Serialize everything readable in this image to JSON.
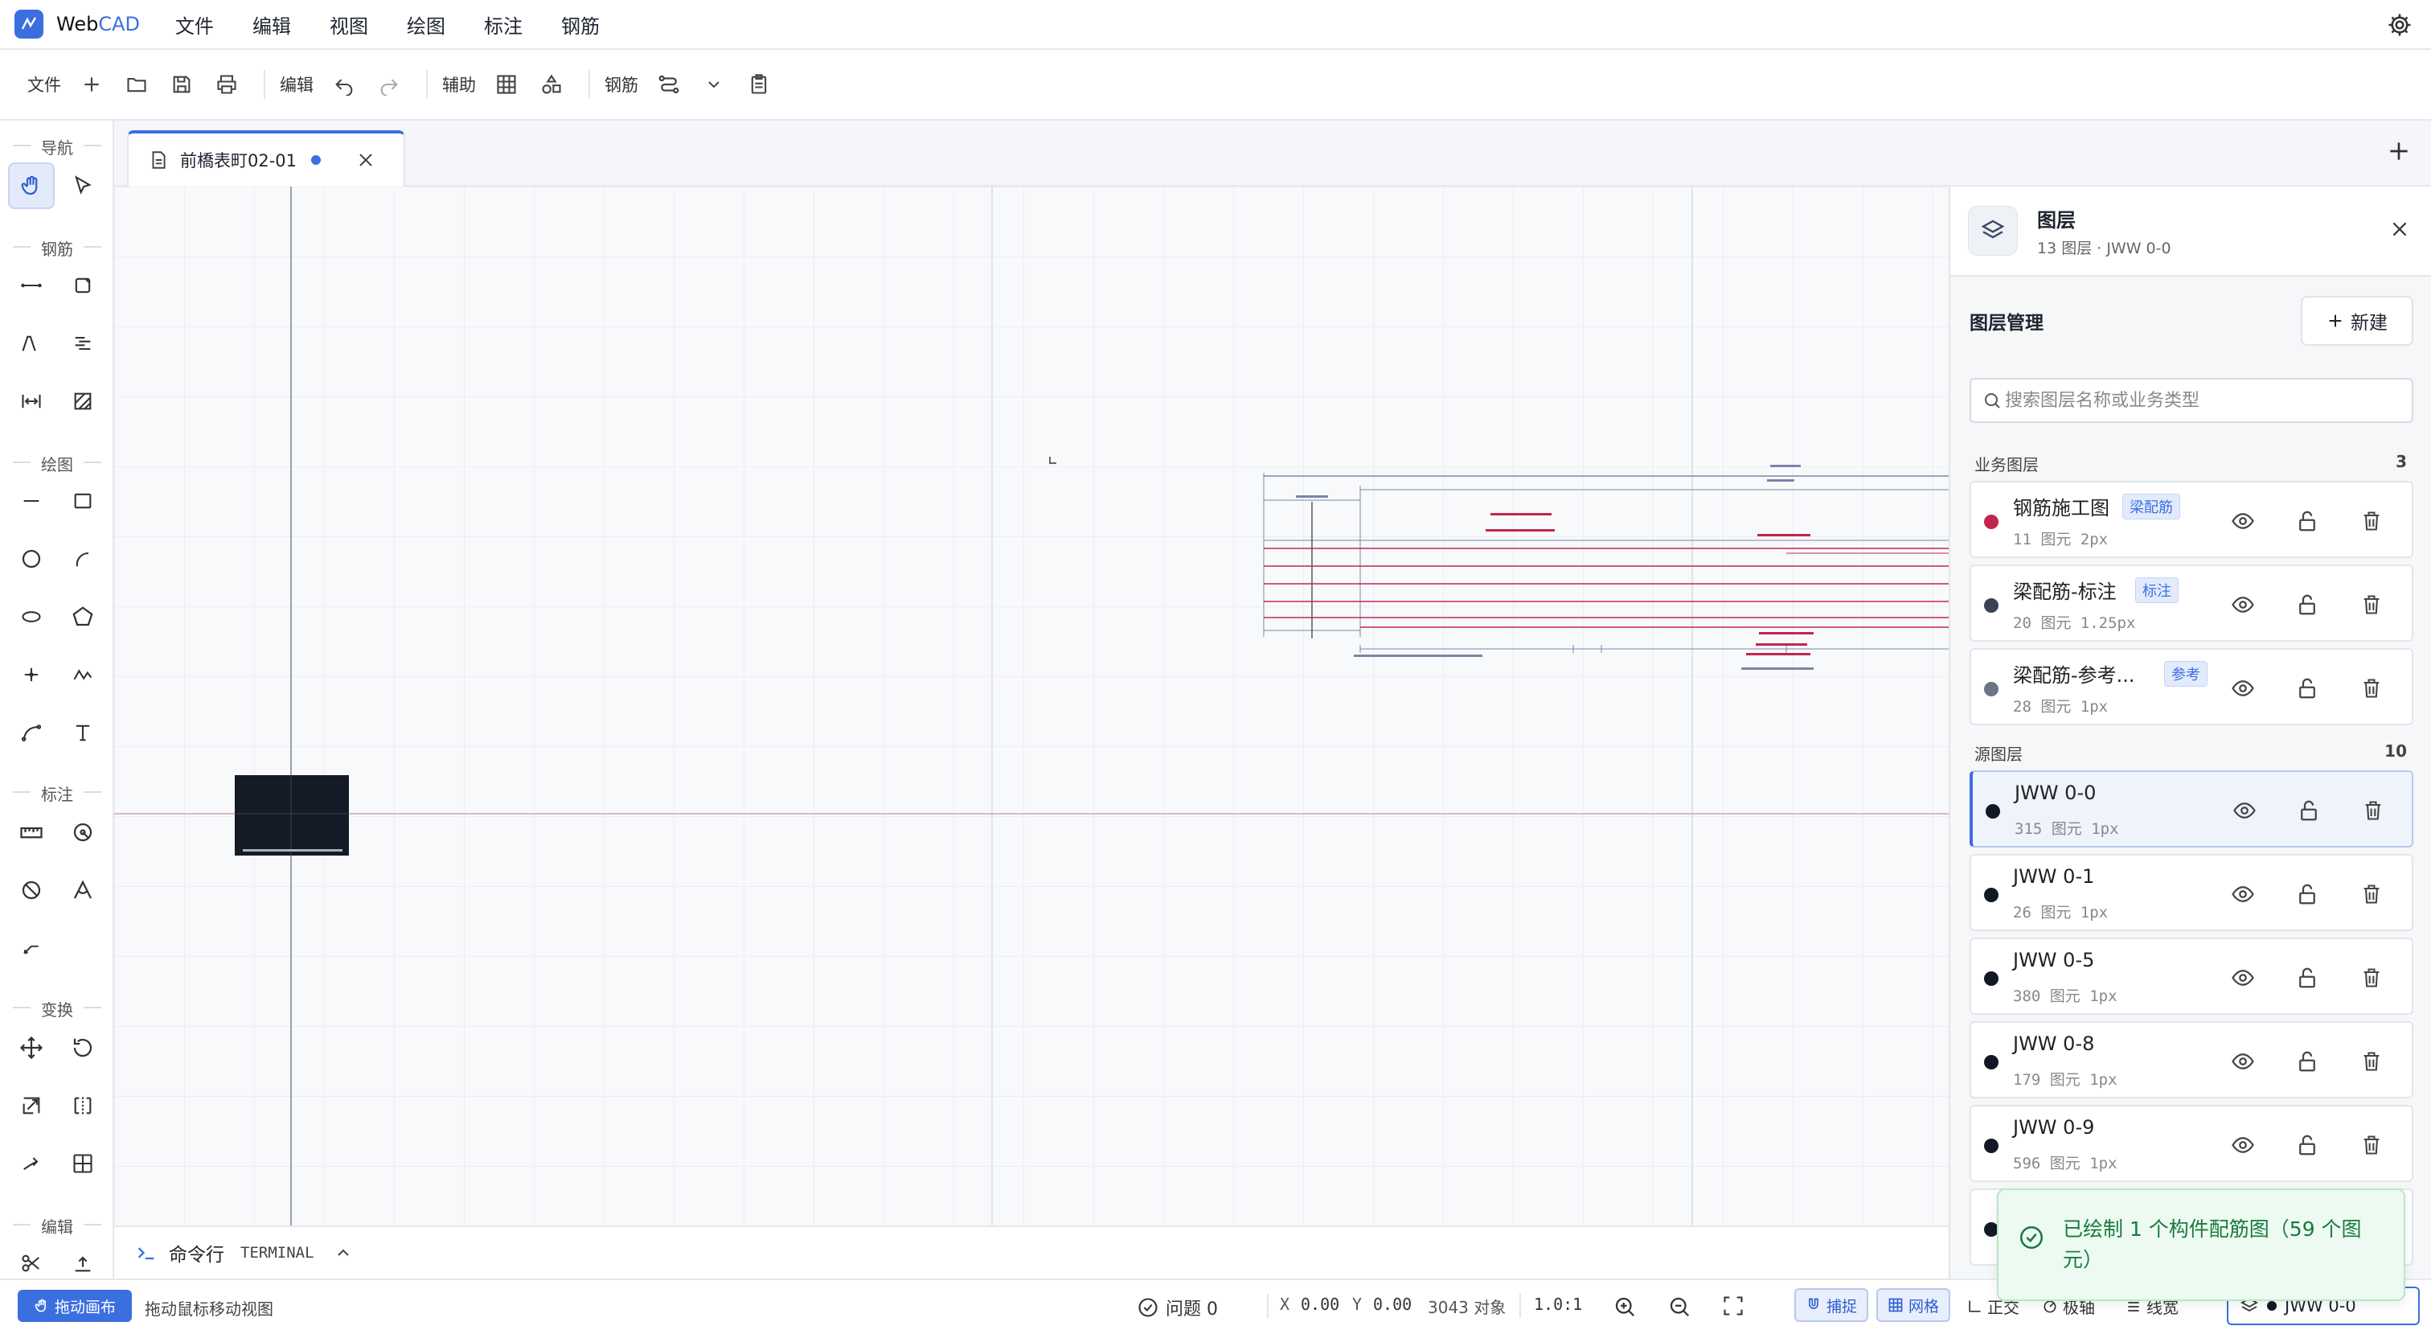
{
  "app": {
    "name_prefix": "Web",
    "name_suffix": "CAD"
  },
  "menu": [
    "文件",
    "编辑",
    "视图",
    "绘图",
    "标注",
    "钢筋"
  ],
  "toolbar": {
    "file_label": "文件",
    "edit_label": "编辑",
    "assist_label": "辅助",
    "rebar_label": "钢筋"
  },
  "leftbar": {
    "sections": {
      "nav": "导航",
      "rebar": "钢筋",
      "draw": "绘图",
      "annotate": "标注",
      "transform": "变换",
      "edit": "编辑"
    }
  },
  "tab": {
    "title": "前橋表町02-01"
  },
  "panel": {
    "title": "图层",
    "subtitle": "13 图层 · JWW 0-0",
    "manage_title": "图层管理",
    "new_label": "新建",
    "search_placeholder": "搜索图层名称或业务类型",
    "business_group": {
      "label": "业务图层",
      "count": "3"
    },
    "source_group": {
      "label": "源图层",
      "count": "10"
    },
    "business_layers": [
      {
        "name": "钢筋施工图",
        "tag": "梁配筋",
        "meta": "11 图元  2px",
        "color": "#c2264f"
      },
      {
        "name": "梁配筋-标注",
        "tag": "标注",
        "meta": "20 图元  1.25px",
        "color": "#3a4254"
      },
      {
        "name": "梁配筋-参考...",
        "tag": "参考",
        "meta": "28 图元  1px",
        "color": "#6b7385"
      }
    ],
    "source_layers": [
      {
        "name": "JWW 0-0",
        "meta": "315 图元  1px",
        "color": "#121826"
      },
      {
        "name": "JWW 0-1",
        "meta": "26 图元  1px",
        "color": "#121826"
      },
      {
        "name": "JWW 0-5",
        "meta": "380 图元  1px",
        "color": "#121826"
      },
      {
        "name": "JWW 0-8",
        "meta": "179 图元  1px",
        "color": "#121826"
      },
      {
        "name": "JWW 0-9",
        "meta": "596 图元  1px",
        "color": "#121826"
      }
    ]
  },
  "cmd": {
    "label": "命令行",
    "terminal": "TERMINAL"
  },
  "status": {
    "drag_button": "拖动画布",
    "drag_hint": "拖动鼠标移动视图",
    "issues": "问题 0",
    "x_label": "X",
    "x_value": "0.00",
    "y_label": "Y",
    "y_value": "0.00",
    "objects": "3043 对象",
    "scale": "1.0:1",
    "snap": "捕捉",
    "grid": "网格",
    "ortho": "正交",
    "polar": "极轴",
    "linewidth": "线宽",
    "layer": "JWW 0-0"
  },
  "toast": {
    "message": "已绘制 1 个构件配筋图（59 个图元）"
  },
  "colors": {
    "accent": "#3b6fe0",
    "rebar_red": "#c2264f",
    "success": "#1b7a3f"
  }
}
